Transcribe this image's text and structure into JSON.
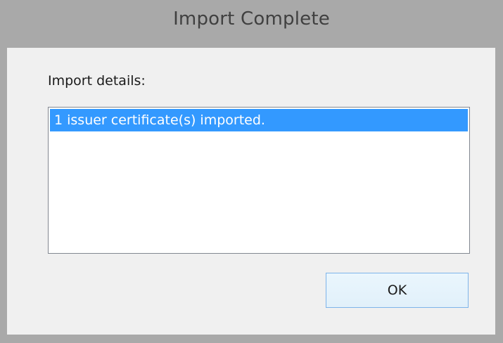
{
  "dialog": {
    "title": "Import Complete",
    "details_label": "Import details:",
    "list_items": [
      {
        "text": "1 issuer certificate(s) imported.",
        "selected": true
      }
    ],
    "ok_label": "OK"
  },
  "colors": {
    "titlebar": "#a9a9a9",
    "client": "#f0f0f0",
    "selection": "#3399ff",
    "button_border": "#7eb4ea"
  }
}
